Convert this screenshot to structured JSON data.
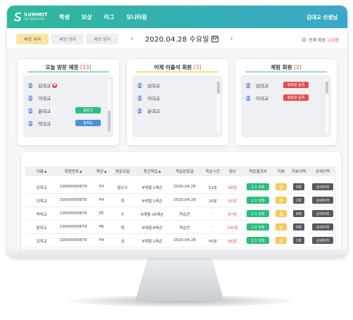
{
  "brand": {
    "title": "SUMMIT",
    "subtitle": "써밋스쿨에듀케이션"
  },
  "nav": [
    "학생",
    "보상",
    "리그",
    "모니터링"
  ],
  "user": {
    "name": "김대교 선생님"
  },
  "tabs": [
    {
      "label": "써밋 국어",
      "active": true
    },
    {
      "label": "써밋 한자",
      "active": false
    },
    {
      "label": "써밋 영어",
      "active": false
    }
  ],
  "date_nav": {
    "prev": "‹",
    "date": "2020.04.28 수요일",
    "next": "›"
  },
  "member_total": {
    "label": "전체 회원",
    "count": "110명"
  },
  "cards": {
    "visit": {
      "title": "오늘 방문 예정",
      "count": "[13]",
      "people": [
        {
          "name": "김대교",
          "badge": "N"
        },
        {
          "name": "이대교"
        },
        {
          "name": "윤대교",
          "chip": "숨원조"
        },
        {
          "name": "박대교",
          "chip": "정취도"
        }
      ]
    },
    "absent": {
      "title": "어제 미출석 회원",
      "count": "[3]",
      "people": [
        {
          "name": "김대교"
        },
        {
          "name": "이대교"
        },
        {
          "name": "윤대교"
        }
      ]
    },
    "trial": {
      "title": "체험 회원",
      "count": "[2]",
      "people": [
        {
          "name": "김대교",
          "chip": "정회원 등록"
        },
        {
          "name": "이대교",
          "chip": "정회원 등록"
        }
      ]
    }
  },
  "table": {
    "headers": [
      "이름",
      "회원번호",
      "학년",
      "방문요일",
      "최근학습",
      "학습완료일",
      "학습시간",
      "점수",
      "학습결과서",
      "리뷰",
      "리뷰이력",
      "상세이력"
    ],
    "rows": [
      {
        "name": "김대교",
        "id": "10000000879",
        "grade": "P3",
        "days": "월2/수",
        "recent": "4레벨-1레슨",
        "done": "2020.04.28",
        "time": "51분",
        "score": "88점",
        "result": "1:1 코칭",
        "review_count": "0회",
        "detail": "상세이력"
      },
      {
        "name": "이대교",
        "id": "10000000879",
        "grade": "P4",
        "days": "화",
        "recent": "4레벨-1레슨",
        "done": "2020.04.28",
        "time": "20분",
        "score": "90점",
        "result": "1:1 코칭",
        "review_count": "2회",
        "detail": "상세이력"
      },
      {
        "name": "박대교",
        "id": "10000000879",
        "grade": "P5",
        "days": "수",
        "recent": "5레벨-16레슨",
        "done": "학습전",
        "time": "-",
        "score": "87점",
        "result": "1:1 코칭",
        "review_count": "6회",
        "detail": "상세이력"
      },
      {
        "name": "윤대교",
        "id": "10000000879",
        "grade": "P6",
        "days": "목",
        "recent": "6레벨-8레슨",
        "done": "학습전",
        "time": "-",
        "score": "100점",
        "result": "1:1 코칭",
        "review_count": "0회",
        "detail": "상세이력"
      },
      {
        "name": "김대교",
        "id": "10000000879",
        "grade": "P4",
        "days": "금",
        "recent": "4레벨-1레슨",
        "done": "2020.04.28",
        "time": "45분",
        "score": "86점",
        "result": "1:1 코칭",
        "review_count": "1회",
        "detail": "상세이력"
      }
    ]
  },
  "colors": {
    "top_gradient_start": "#2fb89a",
    "top_gradient_end": "#3aa8c8",
    "accent_red": "#e24d4d",
    "green_button": "#2ebd7c",
    "yellow_button": "#f7c85a",
    "dark_button": "#555a60",
    "visit_underline": "#8fdcb1",
    "absent_underline": "#f4df8c",
    "trial_underline": "#a8d0ec",
    "chip_green": "#2ebd7c",
    "chip_blue": "#4b8fdf",
    "chip_red": "#e24d4d"
  }
}
